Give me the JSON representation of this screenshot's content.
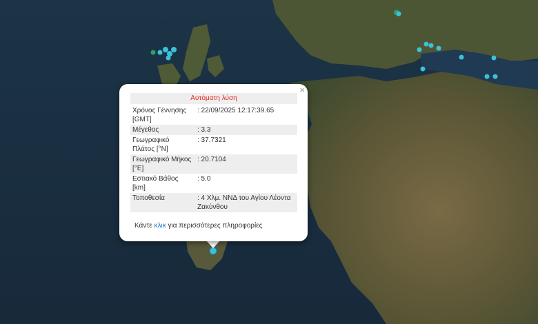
{
  "popup": {
    "title": "Αυτόματη λύση",
    "close_label": "×",
    "rows": [
      {
        "label": "Χρόνος Γέννησης [GMT]",
        "value": ": 22/09/2025 12:17:39.65"
      },
      {
        "label": "Μέγεθος",
        "value": ": 3.3"
      },
      {
        "label": "Γεωγραφικό Πλάτος [°N]",
        "value": ": 37.7321"
      },
      {
        "label": "Γεωγραφικό Μήκος [°E]",
        "value": ": 20.7104"
      },
      {
        "label": "Εστιακό Βάθος [km]",
        "value": ": 5.0"
      },
      {
        "label": "Τοποθεσία",
        "value": ": 4 Χλμ. ΝΝΔ του Αγίου Λέοντα Ζακύνθου"
      }
    ],
    "more_prefix": "Κάντε ",
    "more_link": "κλικ",
    "more_suffix": " για περισσότερες πληροφορίες"
  },
  "colors": {
    "sea": "#1b2f3f",
    "land": "#5e5a3c",
    "marker": "#3cc2d6",
    "marker_alt": "#2e9e6a",
    "title_red": "#e0261b",
    "link": "#1a73c8"
  }
}
